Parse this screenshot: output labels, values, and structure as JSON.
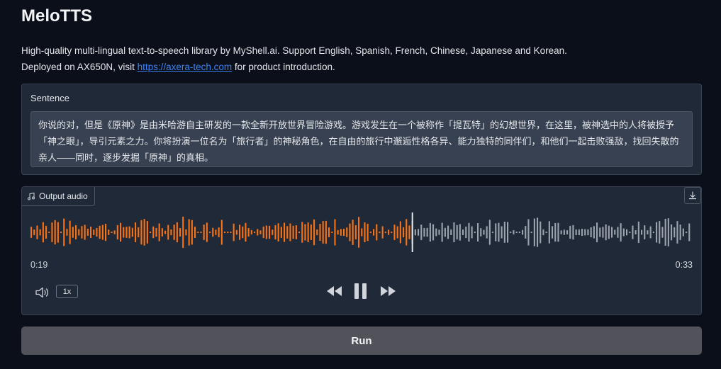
{
  "app": {
    "title": "MeloTTS",
    "description_line1": "High-quality multi-lingual text-to-speech library by MyShell.ai. Support English, Spanish, French, Chinese, Japanese and Korean.",
    "description_line2_prefix": "Deployed on AX650N, visit ",
    "description_link": "https://axera-tech.com",
    "description_line2_suffix": " for product introduction."
  },
  "sentence": {
    "label": "Sentence",
    "value": "你说的对，但是《原神》是由米哈游自主研发的一款全新开放世界冒险游戏。游戏发生在一个被称作「提瓦特」的幻想世界，在这里，被神选中的人将被授予「神之眼」，导引元素之力。你将扮演一位名为「旅行者」的神秘角色，在自由的旅行中邂逅性格各异、能力独特的同伴们，和他们一起击败强敌，找回失散的亲人——同时，逐步发掘「原神」的真相。"
  },
  "audio": {
    "label": "Output audio",
    "current_time": "0:19",
    "duration": "0:33",
    "playback_rate": "1x",
    "progress": 0.5757,
    "played_color": "#f97316",
    "unplayed_color": "#9ca3af",
    "icons": {
      "label": "music-note-icon",
      "download": "download-icon",
      "volume": "volume-icon",
      "rewind": "rewind-icon",
      "pause": "pause-icon",
      "forward": "fast-forward-icon"
    }
  },
  "run_button": {
    "label": "Run"
  }
}
